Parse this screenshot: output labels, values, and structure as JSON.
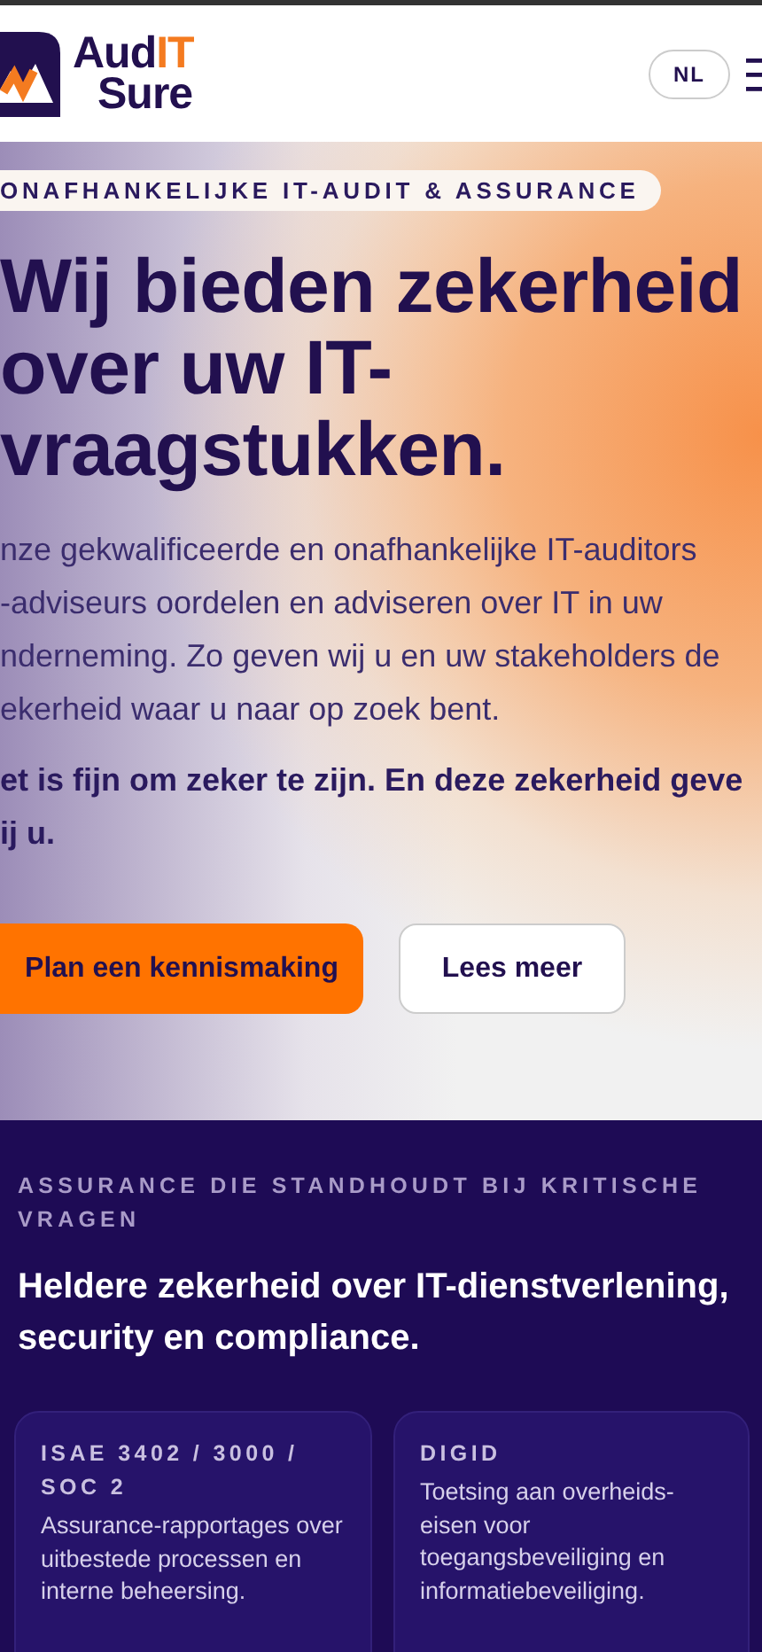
{
  "header": {
    "logo": {
      "part1": "Aud",
      "part2": "IT",
      "line2": "Sure"
    },
    "language": "NL"
  },
  "hero": {
    "tag": "ONAFHANKELIJKE IT-AUDIT & ASSURANCE",
    "heading_lines": [
      "Wij bieden zekerheid",
      "over uw IT-",
      "vraagstukken."
    ],
    "paragraph_lines": [
      "nze gekwalificeerde en onafhankelijke IT-auditors",
      "-adviseurs oordelen en adviseren over IT in uw",
      "nderneming. Zo geven wij u en uw stakeholders de",
      "ekerheid waar u naar op zoek bent."
    ],
    "bold_lines": [
      "et is fijn om zeker te zijn. En deze zekerheid geve",
      "ij u."
    ],
    "buttons": [
      {
        "label": "Plan een kennismaking",
        "kind": "primary"
      },
      {
        "label": "Lees meer",
        "kind": "secondary"
      }
    ]
  },
  "section": {
    "eyebrow": "ASSURANCE DIE STANDHOUDT BIJ KRITISCHE VRAGEN",
    "title": "Heldere zekerheid over IT-dienstverlening, security en compliance.",
    "cards": [
      {
        "title": "ISAE 3402 / 3000 / SOC 2",
        "text": "Assurance-rapportages over uitbestede processen en interne beheersing."
      },
      {
        "title": "DIGID",
        "text": "Toetsing aan overheids-eisen voor toegangsbeveiliging en informatiebeveiliging."
      }
    ]
  }
}
